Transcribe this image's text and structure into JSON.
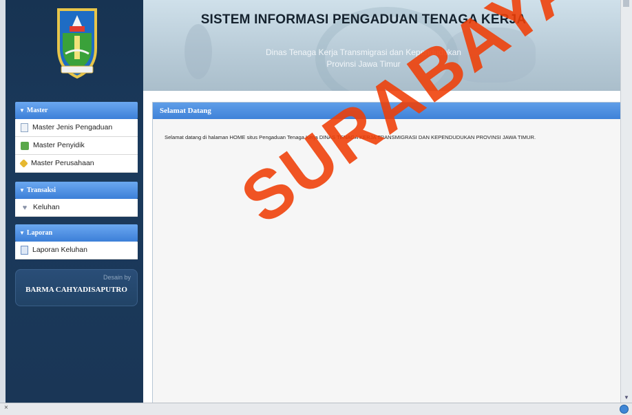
{
  "header": {
    "title": "SISTEM INFORMASI PENGADUAN TENAGA KERJA",
    "subtitle_line1": "Dinas Tenaga Kerja Transmigrasi dan Kependudukan",
    "subtitle_line2": "Provinsi Jawa Timur"
  },
  "menus": {
    "master": {
      "title": "Master",
      "items": [
        "Master Jenis Pengaduan",
        "Master Penyidik",
        "Master Perusahaan"
      ]
    },
    "transaksi": {
      "title": "Transaksi",
      "items": [
        "Keluhan"
      ]
    },
    "laporan": {
      "title": "Laporan",
      "items": [
        "Laporan Keluhan"
      ]
    }
  },
  "badge": {
    "by": "Desain by",
    "name": "BARMA CAHYADISAPUTRO"
  },
  "content": {
    "title": "Selamat Datang",
    "text": "Selamat datang di halaman HOME situs Pengaduan Tenaga Kerja DINAS TENAGA KERJA TRANSMIGRASI DAN KEPENDUDUKAN PROVINSI JAWA TIMUR."
  },
  "status": {
    "close_glyph": "×"
  },
  "watermark": {
    "text": "SURABAYA"
  },
  "colors": {
    "sidebar_bg": "#1b3a5c",
    "menu_header": "#3c7fd8",
    "watermark": "#ef3e06"
  }
}
